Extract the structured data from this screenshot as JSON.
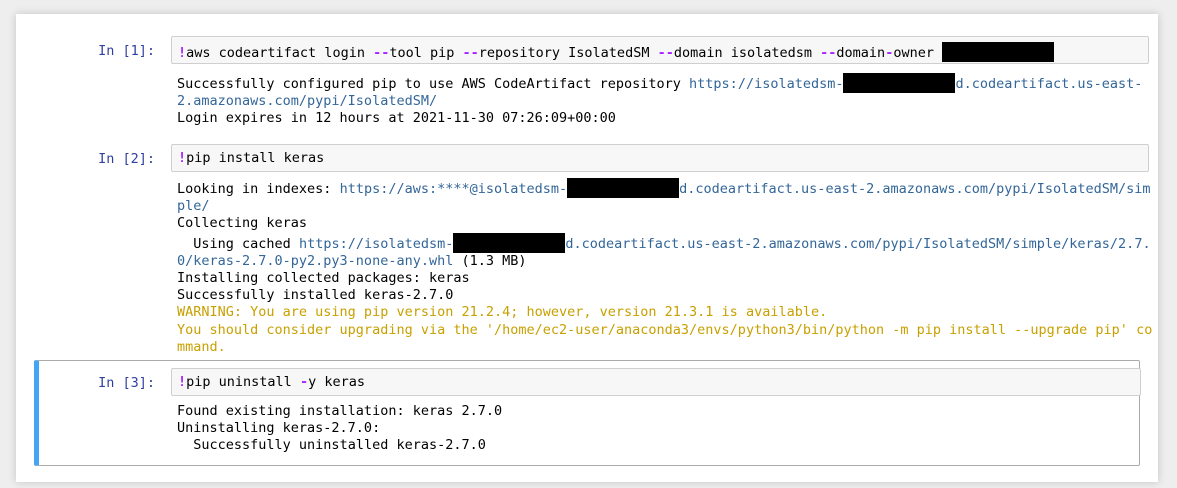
{
  "cells": [
    {
      "prompt": "In [1]:",
      "input": {
        "bang": "!",
        "parts": [
          "aws codeartifact login ",
          "--",
          "tool pip ",
          "--",
          "repository IsolatedSM ",
          "--",
          "domain isolatedsm ",
          "--",
          "domain",
          "-",
          "owner "
        ]
      },
      "output": {
        "line1_text": "Successfully configured pip to use AWS CodeArtifact repository ",
        "line1_link_a": "https://isolatedsm-",
        "line1_link_b": "d.codeartifact.us-east-2.amazonaws.com/pypi/IsolatedSM/",
        "line2": "Login expires in 12 hours at 2021-11-30 07:26:09+00:00"
      }
    },
    {
      "prompt": "In [2]:",
      "input": {
        "bang": "!",
        "text": "pip install keras"
      },
      "output": {
        "l1_text": "Looking in indexes: ",
        "l1_link_a": "https://aws:****@isolatedsm-",
        "l1_link_b": "d.codeartifact.us-east-2.amazonaws.com/pypi/IsolatedSM/simple/",
        "l2": "Collecting keras",
        "l3_text": "  Using cached ",
        "l3_link_a": "https://isolatedsm-",
        "l3_link_b": "d.codeartifact.us-east-2.amazonaws.com/pypi/IsolatedSM/simple/keras/2.7.0/keras-2.7.0-py2.py3-none-any.whl",
        "l3_size": " (1.3 MB)",
        "l4": "Installing collected packages: keras",
        "l5": "Successfully installed keras-2.7.0",
        "w1": "WARNING: You are using pip version 21.2.4; however, version 21.3.1 is available.",
        "w2": "You should consider upgrading via the '/home/ec2-user/anaconda3/envs/python3/bin/python -m pip install --upgrade pip' command."
      }
    },
    {
      "prompt": "In [3]:",
      "input": {
        "bang": "!",
        "t1": "pip uninstall ",
        "op": "-",
        "t2": "y keras"
      },
      "output": {
        "l1": "Found existing installation: keras 2.7.0",
        "l2": "Uninstalling keras-2.7.0:",
        "l3": "  Successfully uninstalled keras-2.7.0"
      }
    }
  ]
}
